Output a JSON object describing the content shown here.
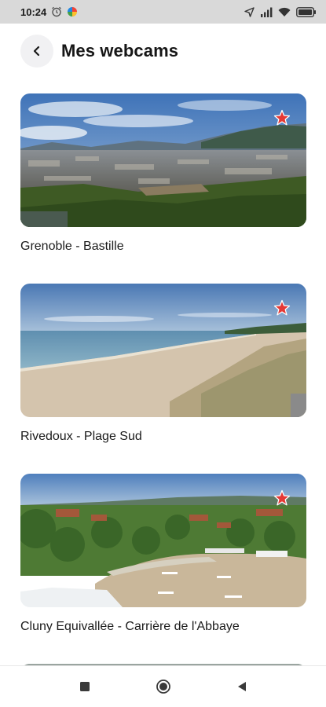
{
  "status_bar": {
    "time": "10:24",
    "left_icons": [
      "alarm-icon",
      "app-notification-icon"
    ],
    "right_icons": [
      "location-icon",
      "signal-icon",
      "wifi-icon",
      "battery-icon"
    ]
  },
  "header": {
    "title": "Mes webcams",
    "back_icon": "chevron-left-icon"
  },
  "webcams": [
    {
      "label": "Grenoble - Bastille",
      "favorite": true
    },
    {
      "label": "Rivedoux - Plage Sud",
      "favorite": true
    },
    {
      "label": "Cluny Equivallée - Carrière de l'Abbaye",
      "favorite": true
    }
  ],
  "nav_bar": {
    "buttons": [
      "recent-apps-icon",
      "home-icon",
      "back-icon"
    ]
  },
  "colors": {
    "favorite_star": "#e53935",
    "status_bar_bg": "#d9d9d9",
    "back_button_bg": "#f1f1f3"
  }
}
